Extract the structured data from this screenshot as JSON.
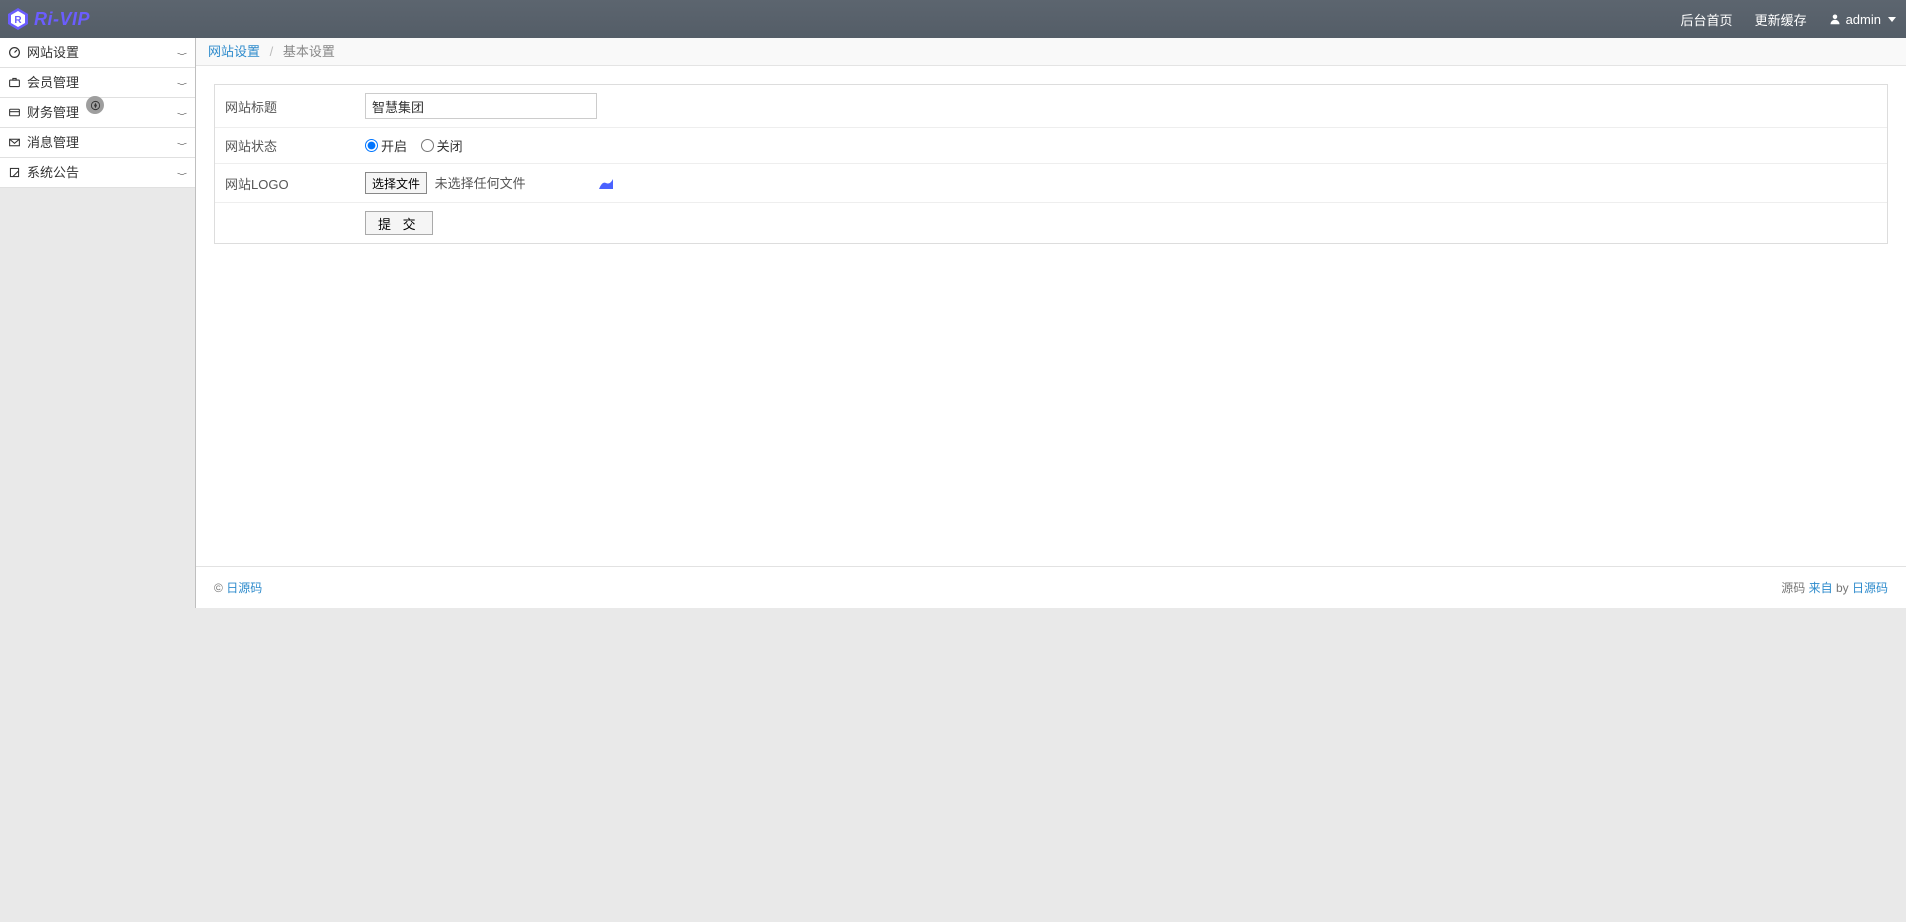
{
  "header": {
    "brand_text": "Ri-VIP",
    "links": {
      "home": "后台首页",
      "cache": "更新缓存"
    },
    "user": "admin"
  },
  "sidebar": {
    "items": [
      {
        "label": "网站设置",
        "icon": "dashboard-icon"
      },
      {
        "label": "会员管理",
        "icon": "briefcase-icon"
      },
      {
        "label": "财务管理",
        "icon": "card-icon"
      },
      {
        "label": "消息管理",
        "icon": "mail-icon"
      },
      {
        "label": "系统公告",
        "icon": "edit-icon"
      }
    ]
  },
  "breadcrumb": {
    "root": "网站设置",
    "current": "基本设置"
  },
  "form": {
    "title_label": "网站标题",
    "title_value": "智慧集团",
    "status_label": "网站状态",
    "status_on": "开启",
    "status_off": "关闭",
    "logo_label": "网站LOGO",
    "file_button": "选择文件",
    "file_none": "未选择任何文件",
    "submit": "提 交"
  },
  "footer": {
    "copy_prefix": "© ",
    "copy_link": "日源码",
    "right_prefix": "源码 ",
    "right_link1": "来自",
    "right_mid": " by ",
    "right_link2": "日源码"
  }
}
